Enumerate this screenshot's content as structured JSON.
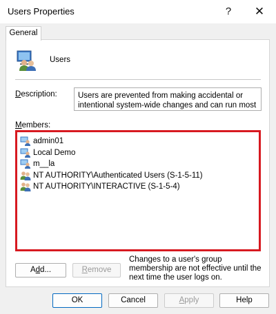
{
  "window": {
    "title": "Users Properties",
    "help_glyph": "?",
    "close_glyph": "✕"
  },
  "tabs": [
    {
      "label": "General",
      "selected": true
    }
  ],
  "general": {
    "group_name": "Users",
    "group_icon": "users-group-icon",
    "description_label": "Description:",
    "description_value": "Users are prevented from making accidental or intentional system-wide changes and can run most",
    "members_label": "Members:",
    "members": [
      {
        "name": "admin01",
        "icon": "user-icon"
      },
      {
        "name": "Local Demo",
        "icon": "user-icon"
      },
      {
        "name": "m__la",
        "icon": "user-icon"
      },
      {
        "name": "NT AUTHORITY\\Authenticated Users (S-1-5-11)",
        "icon": "group-icon"
      },
      {
        "name": "NT AUTHORITY\\INTERACTIVE (S-1-5-4)",
        "icon": "group-icon"
      }
    ],
    "add_label": "Add...",
    "remove_label": "Remove",
    "note": "Changes to a user's group membership are not effective until the next time the user logs on."
  },
  "footer": {
    "ok_label": "OK",
    "cancel_label": "Cancel",
    "apply_label": "Apply",
    "help_label": "Help"
  },
  "colors": {
    "highlight_border": "#d71920",
    "primary_button_border": "#0067c0"
  }
}
